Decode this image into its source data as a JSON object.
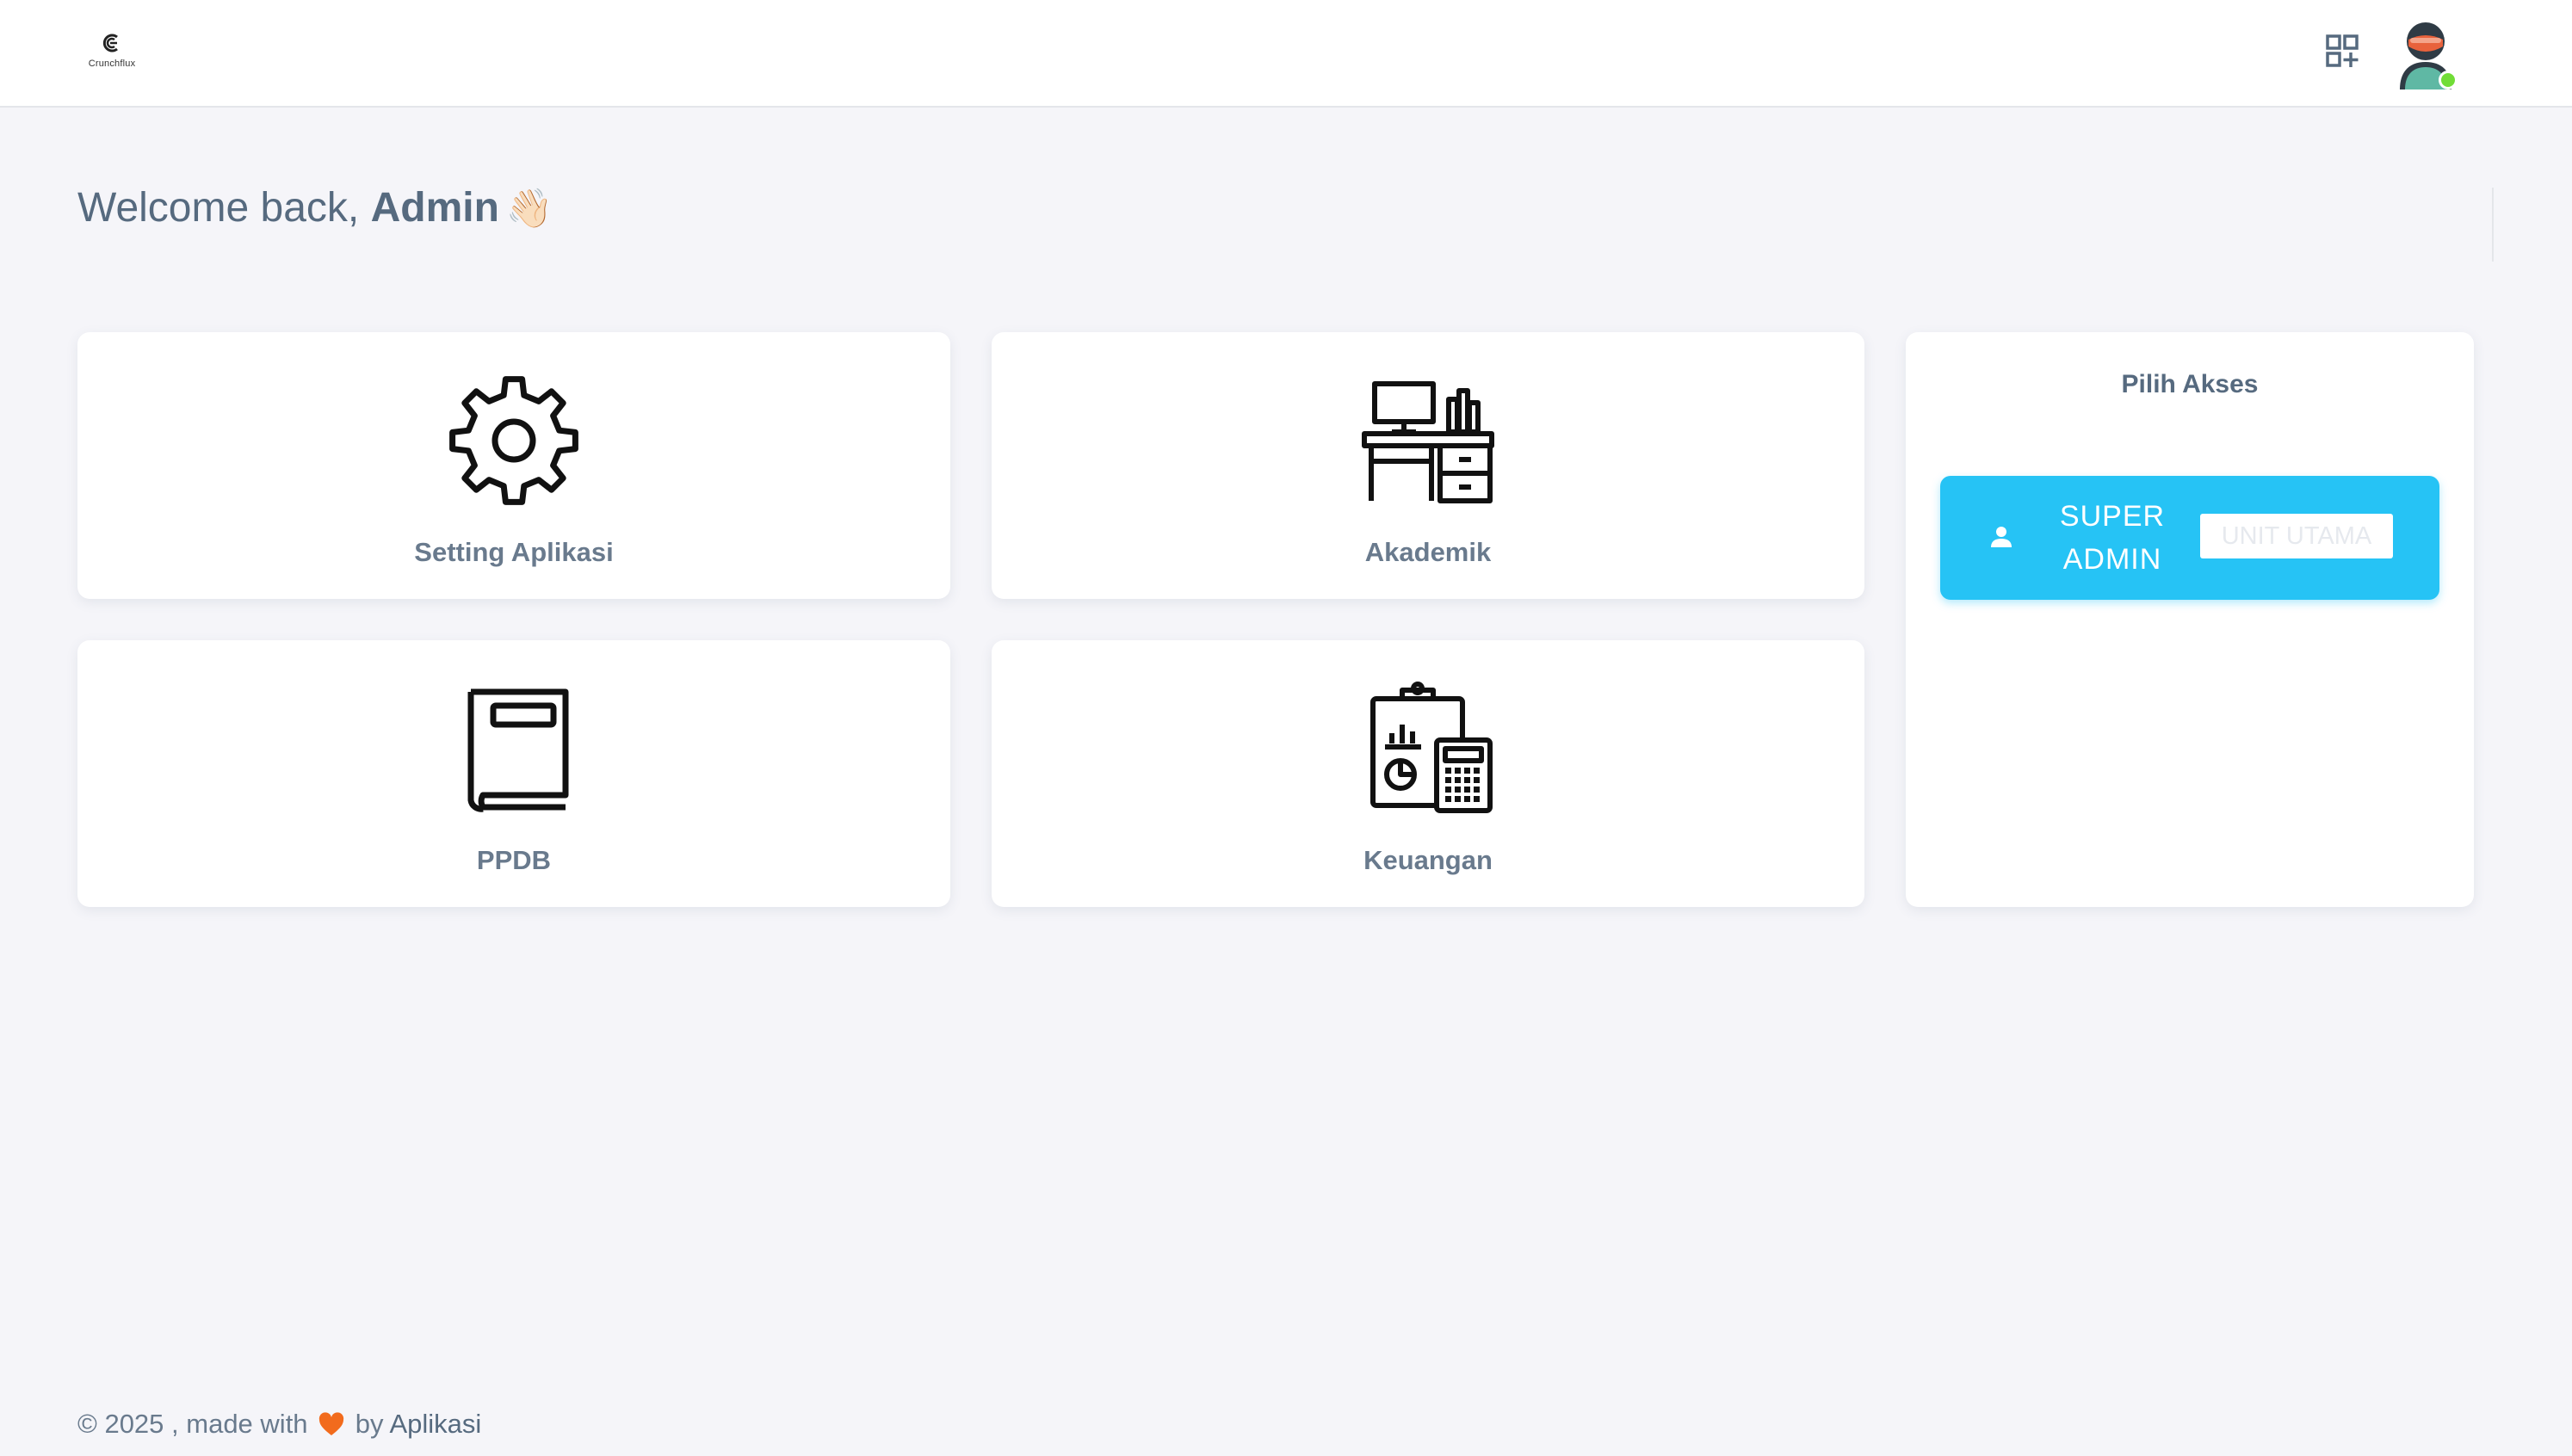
{
  "header": {
    "logo_text": "Crunchflux",
    "icons": {
      "apps": "apps-add-icon",
      "avatar": "user-avatar"
    }
  },
  "welcome": {
    "prefix": "Welcome back, ",
    "name": "Admin",
    "emoji": "👋🏻"
  },
  "modules": [
    {
      "label": "Setting Aplikasi",
      "icon": "gear-icon"
    },
    {
      "label": "Akademik",
      "icon": "desk-icon"
    },
    {
      "label": "PPDB",
      "icon": "book-icon"
    },
    {
      "label": "Keuangan",
      "icon": "finance-report-icon"
    }
  ],
  "access": {
    "title": "Pilih Akses",
    "role": "SUPER ADMIN",
    "unit": "UNIT UTAMA",
    "icon": "person-icon"
  },
  "footer": {
    "prefix": "© 2025 , made with",
    "by": "by",
    "brand": "Aplikasi"
  },
  "colors": {
    "accent": "#26c3f5",
    "background": "#f5f5f9",
    "text": "#566a7f",
    "heart": "#f26b1d",
    "online": "#71dd37"
  }
}
